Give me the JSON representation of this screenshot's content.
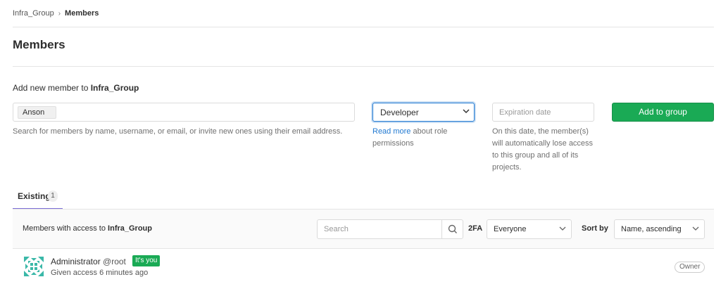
{
  "breadcrumb": {
    "group": "Infra_Group",
    "separator": "›",
    "current": "Members"
  },
  "page_title": "Members",
  "add_member": {
    "heading_prefix": "Add new member to ",
    "heading_group": "Infra_Group",
    "token": "Anson",
    "help": "Search for members by name, username, or email, or invite new ones using their email address.",
    "role_value": "Developer",
    "role_help_link": "Read more",
    "role_help_rest": " about role permissions",
    "expiration_placeholder": "Expiration date",
    "expiration_help": "On this date, the member(s) will automatically lose access to this group and all of its projects.",
    "add_button": "Add to group"
  },
  "tabs": [
    {
      "label": "Existing",
      "count": "1"
    }
  ],
  "filter": {
    "title_prefix": "Members with access to ",
    "title_group": "Infra_Group",
    "search_placeholder": "Search",
    "twofa_label": "2FA",
    "twofa_value": "Everyone",
    "sort_label": "Sort by",
    "sort_value": "Name, ascending"
  },
  "members": [
    {
      "name": "Administrator",
      "username": "@root",
      "badge": "It's you",
      "meta": "Given access 6 minutes ago",
      "role": "Owner"
    }
  ],
  "colors": {
    "accent_green": "#1aaa55",
    "link_blue": "#1f78d1",
    "tab_underline": "#7c6ed6",
    "avatar_teal": "#3ab8a8"
  },
  "icons": {
    "breadcrumb_separator": "chevron-right-icon",
    "select_arrow": "chevron-down-icon",
    "search": "search-icon"
  }
}
